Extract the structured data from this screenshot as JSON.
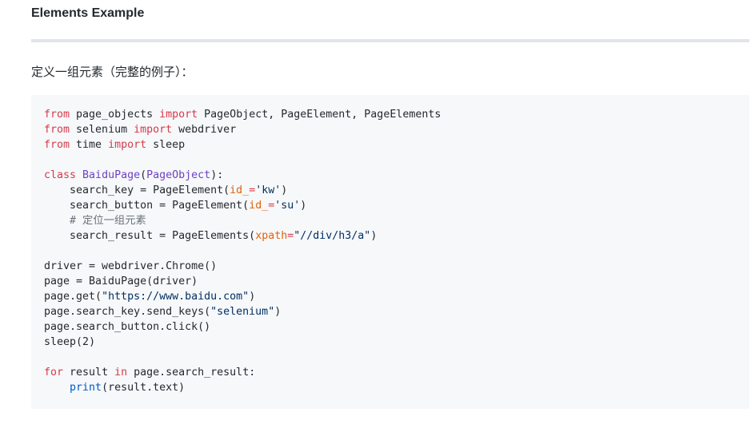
{
  "heading": "Elements Example",
  "description": "定义一组元素（完整的例子）：",
  "colors": {
    "keyword": "#d73a49",
    "class_name": "#6f42c1",
    "parameter": "#e36209",
    "string": "#032f62",
    "comment": "#6a737d",
    "builtin": "#005cc5",
    "plain": "#24292e",
    "code_background": "#f6f8fa"
  },
  "code": {
    "language": "python",
    "lines": [
      [
        {
          "t": "kw",
          "v": "from"
        },
        {
          "t": "p",
          "v": " page_objects "
        },
        {
          "t": "kw",
          "v": "import"
        },
        {
          "t": "p",
          "v": " PageObject, PageElement, PageElements"
        }
      ],
      [
        {
          "t": "kw",
          "v": "from"
        },
        {
          "t": "p",
          "v": " selenium "
        },
        {
          "t": "kw",
          "v": "import"
        },
        {
          "t": "p",
          "v": " webdriver"
        }
      ],
      [
        {
          "t": "kw",
          "v": "from"
        },
        {
          "t": "p",
          "v": " time "
        },
        {
          "t": "kw",
          "v": "import"
        },
        {
          "t": "p",
          "v": " sleep"
        }
      ],
      [],
      [
        {
          "t": "kw",
          "v": "class"
        },
        {
          "t": "p",
          "v": " "
        },
        {
          "t": "cls",
          "v": "BaiduPage"
        },
        {
          "t": "p",
          "v": "("
        },
        {
          "t": "cls",
          "v": "PageObject"
        },
        {
          "t": "p",
          "v": "):"
        }
      ],
      [
        {
          "t": "p",
          "v": "    search_key = PageElement("
        },
        {
          "t": "param",
          "v": "id_"
        },
        {
          "t": "kw",
          "v": "="
        },
        {
          "t": "str",
          "v": "'kw'"
        },
        {
          "t": "p",
          "v": ")"
        }
      ],
      [
        {
          "t": "p",
          "v": "    search_button = PageElement("
        },
        {
          "t": "param",
          "v": "id_"
        },
        {
          "t": "kw",
          "v": "="
        },
        {
          "t": "str",
          "v": "'su'"
        },
        {
          "t": "p",
          "v": ")"
        }
      ],
      [
        {
          "t": "p",
          "v": "    "
        },
        {
          "t": "cmt",
          "v": "# 定位一组元素"
        }
      ],
      [
        {
          "t": "p",
          "v": "    search_result = PageElements("
        },
        {
          "t": "param",
          "v": "xpath"
        },
        {
          "t": "kw",
          "v": "="
        },
        {
          "t": "str",
          "v": "\"//div/h3/a\""
        },
        {
          "t": "p",
          "v": ")"
        }
      ],
      [],
      [
        {
          "t": "p",
          "v": "driver = webdriver.Chrome()"
        }
      ],
      [
        {
          "t": "p",
          "v": "page = BaiduPage(driver)"
        }
      ],
      [
        {
          "t": "p",
          "v": "page.get("
        },
        {
          "t": "str",
          "v": "\"https://www.baidu.com\""
        },
        {
          "t": "p",
          "v": ")"
        }
      ],
      [
        {
          "t": "p",
          "v": "page.search_key.send_keys("
        },
        {
          "t": "str",
          "v": "\"selenium\""
        },
        {
          "t": "p",
          "v": ")"
        }
      ],
      [
        {
          "t": "p",
          "v": "page.search_button.click()"
        }
      ],
      [
        {
          "t": "p",
          "v": "sleep("
        },
        {
          "t": "p",
          "v": "2"
        },
        {
          "t": "p",
          "v": ")"
        }
      ],
      [],
      [
        {
          "t": "kw",
          "v": "for"
        },
        {
          "t": "p",
          "v": " result "
        },
        {
          "t": "kw",
          "v": "in"
        },
        {
          "t": "p",
          "v": " page.search_result:"
        }
      ],
      [
        {
          "t": "p",
          "v": "    "
        },
        {
          "t": "bi",
          "v": "print"
        },
        {
          "t": "p",
          "v": "(result.text)"
        }
      ]
    ]
  }
}
